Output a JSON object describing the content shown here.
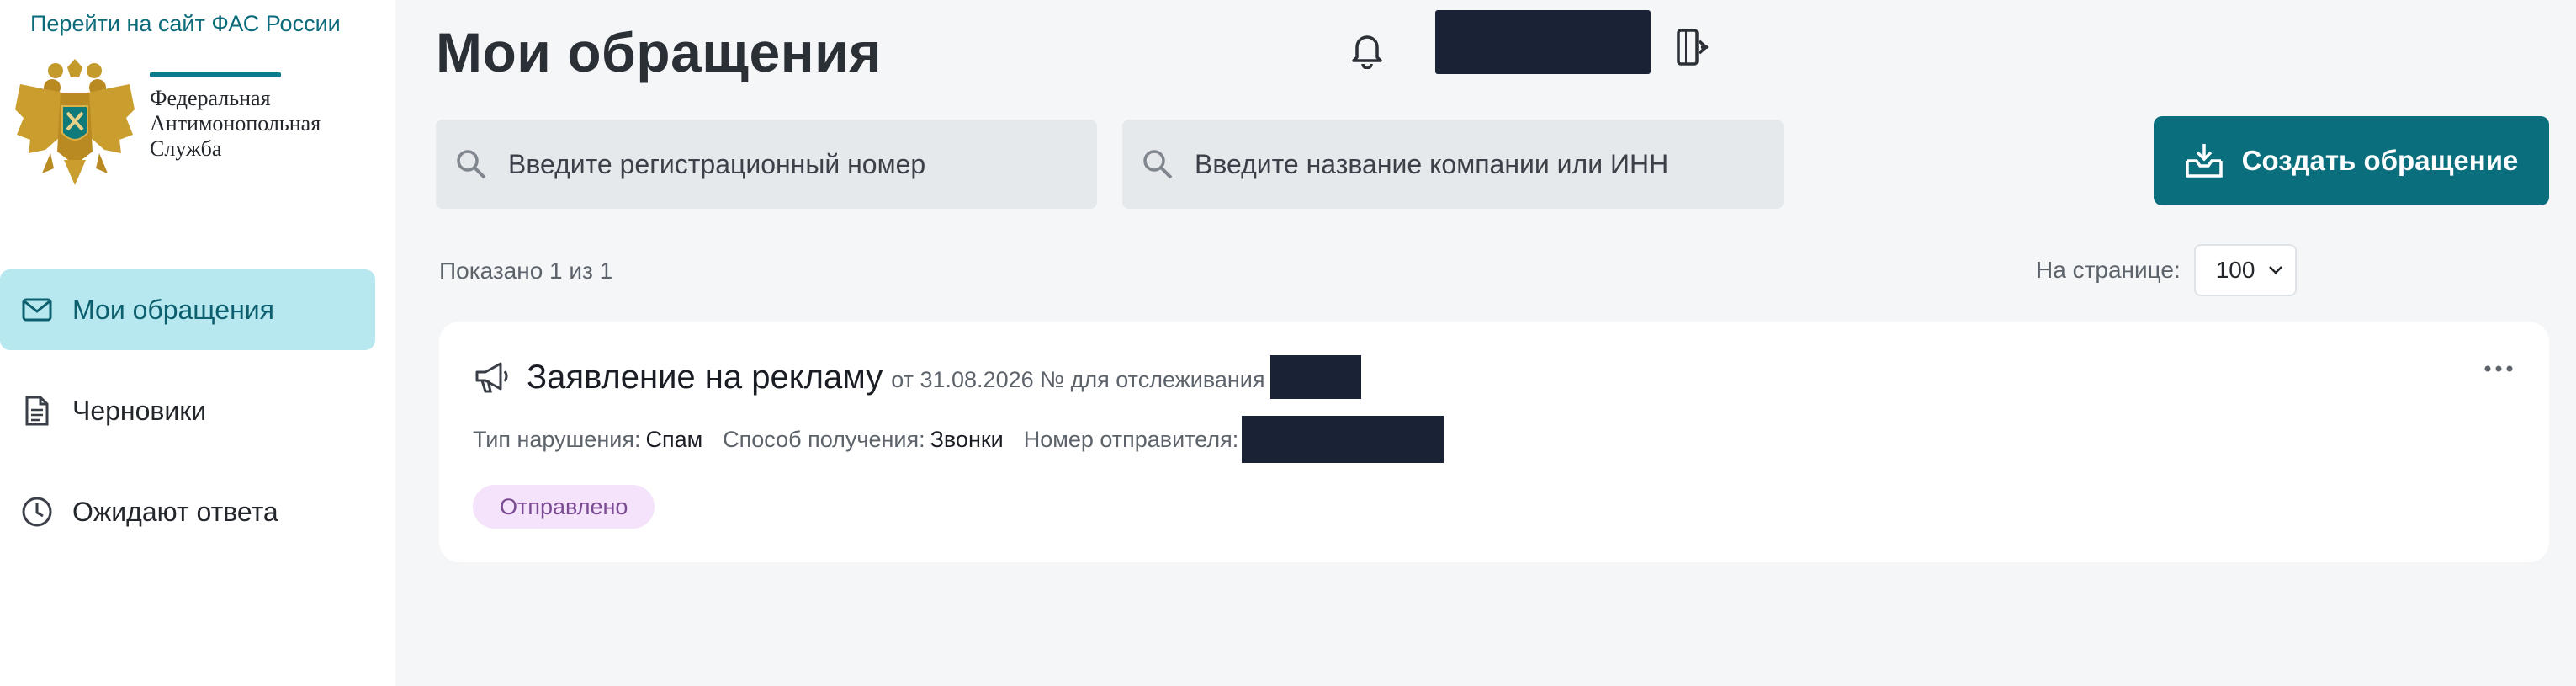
{
  "sidebar": {
    "fas_link": "Перейти на сайт ФАС России",
    "logo_lines": [
      "Федеральная",
      "Антимонопольная",
      "Служба"
    ],
    "items": [
      {
        "label": "Мои обращения",
        "icon": "mail-icon",
        "active": true
      },
      {
        "label": "Черновики",
        "icon": "document-icon",
        "active": false
      },
      {
        "label": "Ожидают ответа",
        "icon": "clock-icon",
        "active": false
      }
    ]
  },
  "header": {
    "title": "Мои обращения",
    "icons": [
      "bell-icon",
      "exit-icon"
    ]
  },
  "search": {
    "reg_number_placeholder": "Введите регистрационный номер",
    "company_placeholder": "Введите название компании или ИНН"
  },
  "actions": {
    "create_label": "Создать обращение"
  },
  "listing": {
    "shown": "Показано 1 из 1",
    "per_page_label": "На странице:",
    "per_page_value": "100"
  },
  "appeals": [
    {
      "title": "Заявление на рекламу",
      "meta": "от 31.08.2026 № для отслеживания",
      "violation_label": "Тип нарушения:",
      "violation_value": "Спам",
      "method_label": "Способ получения:",
      "method_value": "Звонки",
      "sender_label": "Номер отправителя:",
      "status": "Отправлено"
    }
  ],
  "colors": {
    "accent": "#0b6e7d",
    "active_nav_bg": "#b8e8ef",
    "status_bg": "#f4e3fa",
    "status_text": "#7a4a92",
    "redaction": "#1a2335"
  }
}
